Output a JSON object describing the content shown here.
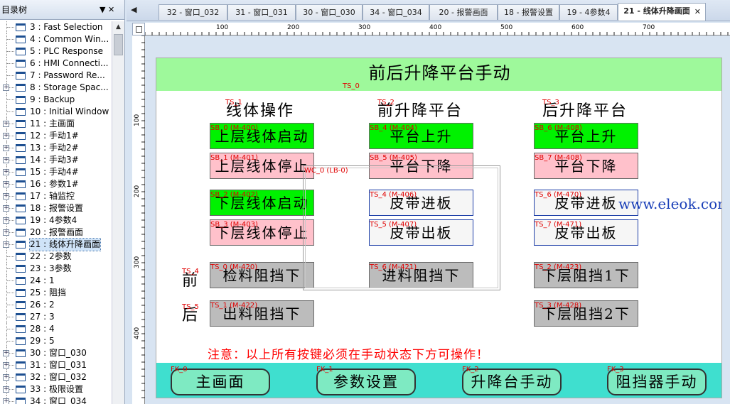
{
  "tree": {
    "header_title": "目录树",
    "header_controls": "▼ ✕",
    "items": [
      {
        "label": "3 : Fast Selection",
        "expandable": false
      },
      {
        "label": "4 : Common Win...",
        "expandable": false
      },
      {
        "label": "5 : PLC Response",
        "expandable": false
      },
      {
        "label": "6 : HMI Connecti...",
        "expandable": false
      },
      {
        "label": "7 : Password Re...",
        "expandable": false
      },
      {
        "label": "8 : Storage Spac...",
        "expandable": true
      },
      {
        "label": "9 : Backup",
        "expandable": false
      },
      {
        "label": "10 : Initial Window",
        "expandable": false
      },
      {
        "label": "11 : 主画面",
        "expandable": true
      },
      {
        "label": "12 : 手动1#",
        "expandable": true
      },
      {
        "label": "13 : 手动2#",
        "expandable": true
      },
      {
        "label": "14 : 手动3#",
        "expandable": true
      },
      {
        "label": "15 : 手动4#",
        "expandable": true
      },
      {
        "label": "16 : 参数1#",
        "expandable": true
      },
      {
        "label": "17 : 轴监控",
        "expandable": true
      },
      {
        "label": "18 : 报警设置",
        "expandable": true
      },
      {
        "label": "19 : 4参数4",
        "expandable": true
      },
      {
        "label": "20 : 报警画面",
        "expandable": true
      },
      {
        "label": "21 : 线体升降画面",
        "expandable": true,
        "selected": true
      },
      {
        "label": "22 : 2参数",
        "expandable": false
      },
      {
        "label": "23 : 3参数",
        "expandable": false
      },
      {
        "label": "24 : 1",
        "expandable": false
      },
      {
        "label": "25 : 阻挡",
        "expandable": false
      },
      {
        "label": "26 : 2",
        "expandable": false
      },
      {
        "label": "27 : 3",
        "expandable": false
      },
      {
        "label": "28 : 4",
        "expandable": false
      },
      {
        "label": "29 : 5",
        "expandable": false
      },
      {
        "label": "30 : 窗口_030",
        "expandable": true
      },
      {
        "label": "31 : 窗口_031",
        "expandable": true
      },
      {
        "label": "32 : 窗口_032",
        "expandable": true
      },
      {
        "label": "33 : 极限设置",
        "expandable": true
      },
      {
        "label": "34 : 窗口_034",
        "expandable": true
      }
    ]
  },
  "tabs": [
    {
      "label": "32 - 窗口_032"
    },
    {
      "label": "31 - 窗口_031"
    },
    {
      "label": "30 - 窗口_030"
    },
    {
      "label": "34 - 窗口_034"
    },
    {
      "label": "20 - 报警画面"
    },
    {
      "label": "18 - 报警设置"
    },
    {
      "label": "19 - 4参数4"
    },
    {
      "label": "21 - 线体升降画面",
      "active": true
    }
  ],
  "tab_close": "✕",
  "tab_nav_left": "◀",
  "ruler": {
    "h_labels": [
      "100",
      "200",
      "300",
      "400",
      "500",
      "600",
      "700"
    ],
    "v_labels": [
      "100",
      "200",
      "300",
      "400"
    ]
  },
  "screen": {
    "title": "前后升降平台手动",
    "title_tag": "TS_0",
    "columns": [
      {
        "heading": "线体操作",
        "tag": "TS_1"
      },
      {
        "heading": "前升降平台",
        "tag": "TS_2"
      },
      {
        "heading": "后升降平台",
        "tag": "TS_3"
      }
    ],
    "buttons": [
      {
        "label": "上层线体启动",
        "tag": "SB_0 (M-400)",
        "style": "green"
      },
      {
        "label": "上层线体停止",
        "tag": "SB_1 (M-401)",
        "style": "pink"
      },
      {
        "label": "下层线体启动",
        "tag": "SB_2 (M-402)",
        "style": "green"
      },
      {
        "label": "下层线体停止",
        "tag": "SB_3 (M-403)",
        "style": "pink"
      },
      {
        "label": "检料阻挡下",
        "tag": "TS_0 (M-420)",
        "style": "gray"
      },
      {
        "label": "出料阻挡下",
        "tag": "TS_1 (M-422)",
        "style": "gray"
      },
      {
        "label": "平台上升",
        "tag": "SB_4 (M-404)",
        "style": "green"
      },
      {
        "label": "平台下降",
        "tag": "SB_5 (M-405)",
        "style": "pink"
      },
      {
        "label": "皮带进板",
        "tag": "TS_4 (M-406)",
        "style": "white"
      },
      {
        "label": "皮带出板",
        "tag": "TS_5 (M-407)",
        "style": "white"
      },
      {
        "label": "进料阻挡下",
        "tag": "TS_6 (M-421)",
        "style": "gray"
      },
      {
        "label": "平台上升",
        "tag": "SB_6 (M-408)",
        "style": "green"
      },
      {
        "label": "平台下降",
        "tag": "SB_7 (M-408)",
        "style": "pink"
      },
      {
        "label": "皮带进板",
        "tag": "TS_6 (M-470)",
        "style": "white"
      },
      {
        "label": "皮带出板",
        "tag": "TS_7 (M-471)",
        "style": "white"
      },
      {
        "label": "下层阻挡1下",
        "tag": "TS_2 (M-423)",
        "style": "gray"
      },
      {
        "label": "下层阻挡2下",
        "tag": "TS_3 (M-428)",
        "style": "gray"
      }
    ],
    "side_labels": [
      {
        "label": "前",
        "tag": "TS_4"
      },
      {
        "label": "后",
        "tag": "TS_5"
      }
    ],
    "window_control_tag": "WC_0 (LB-0)",
    "watermark": "www.eleok.com",
    "notice": "注意：以上所有按键必须在手动状态下方可操作！",
    "footer_buttons": [
      {
        "label": "主画面",
        "tag": "FK_0"
      },
      {
        "label": "参数设置",
        "tag": "FK_1"
      },
      {
        "label": "升降台手动",
        "tag": "FK_2"
      },
      {
        "label": "阻挡器手动",
        "tag": "FK_3"
      }
    ]
  }
}
